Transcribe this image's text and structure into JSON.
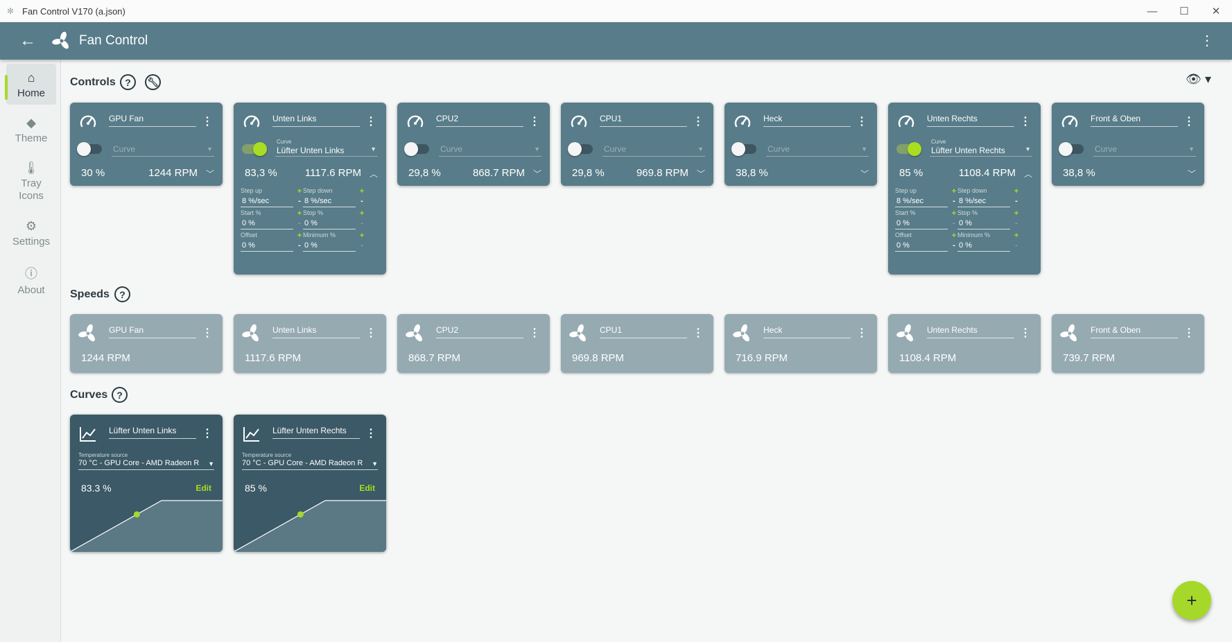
{
  "window": {
    "title": "Fan Control V170 (a.json)"
  },
  "header": {
    "title": "Fan Control"
  },
  "nav": [
    {
      "label": "Home",
      "icon": "home-icon",
      "active": true
    },
    {
      "label": "Theme",
      "icon": "paint-bucket-icon"
    },
    {
      "label": "Tray Icons",
      "icon": "thermometer-icon"
    },
    {
      "label": "Settings",
      "icon": "gear-icon"
    },
    {
      "label": "About",
      "icon": "info-icon"
    }
  ],
  "sections": {
    "controls": "Controls",
    "speeds": "Speeds",
    "curves": "Curves"
  },
  "controls": [
    {
      "name": "GPU Fan",
      "enabled": false,
      "curve": "Curve",
      "percent": "30 %",
      "rpm": "1244 RPM",
      "expanded": false
    },
    {
      "name": "Unten Links",
      "enabled": true,
      "curve_label": "Curve",
      "curve": "Lüfter Unten Links",
      "percent": "83,3 %",
      "rpm": "1117.6 RPM",
      "expanded": true,
      "step_up_label": "Step up",
      "step_up": "8 %/sec",
      "step_down_label": "Step down",
      "step_down": "8 %/sec",
      "start_label": "Start %",
      "start": "0 %",
      "stop_label": "Stop %",
      "stop": "0 %",
      "offset_label": "Offset",
      "offset": "0 %",
      "minimum_label": "Minimum %",
      "minimum": "0 %"
    },
    {
      "name": "CPU2",
      "enabled": false,
      "curve": "Curve",
      "percent": "29,8 %",
      "rpm": "868.7 RPM",
      "expanded": false
    },
    {
      "name": "CPU1",
      "enabled": false,
      "curve": "Curve",
      "percent": "29,8 %",
      "rpm": "969.8 RPM",
      "expanded": false
    },
    {
      "name": "Heck",
      "enabled": false,
      "curve": "Curve",
      "percent": "38,8 %",
      "rpm": "",
      "expanded": false
    },
    {
      "name": "Unten Rechts",
      "enabled": true,
      "curve_label": "Curve",
      "curve": "Lüfter Unten Rechts",
      "percent": "85 %",
      "rpm": "1108.4 RPM",
      "expanded": true,
      "step_up_label": "Step up",
      "step_up": "8 %/sec",
      "step_down_label": "Step down",
      "step_down": "8 %/sec",
      "start_label": "Start %",
      "start": "0 %",
      "stop_label": "Stop %",
      "stop": "0 %",
      "offset_label": "Offset",
      "offset": "0 %",
      "minimum_label": "Minimum %",
      "minimum": "0 %"
    },
    {
      "name": "Front & Oben",
      "enabled": false,
      "curve": "Curve",
      "percent": "38,8 %",
      "rpm": "",
      "expanded": false
    }
  ],
  "speeds": [
    {
      "name": "GPU Fan",
      "value": "1244 RPM"
    },
    {
      "name": "Unten Links",
      "value": "1117.6 RPM"
    },
    {
      "name": "CPU2",
      "value": "868.7 RPM"
    },
    {
      "name": "CPU1",
      "value": "969.8 RPM"
    },
    {
      "name": "Heck",
      "value": "716.9 RPM"
    },
    {
      "name": "Unten Rechts",
      "value": "1108.4 RPM"
    },
    {
      "name": "Front & Oben",
      "value": "739.7 RPM"
    }
  ],
  "curves": [
    {
      "name": "Lüfter Unten Links",
      "temp_label": "Temperature source",
      "temp_source": "70 °C - GPU Core - AMD Radeon R",
      "percent": "83.3 %",
      "edit": "Edit",
      "level": 0.833
    },
    {
      "name": "Lüfter Unten Rechts",
      "temp_label": "Temperature source",
      "temp_source": "70 °C - GPU Core - AMD Radeon R",
      "percent": "85 %",
      "edit": "Edit",
      "level": 0.85
    }
  ],
  "colors": {
    "accent": "#a6d82a",
    "header": "#587c89",
    "card": "#587c89",
    "speed_card": "#96aab2",
    "curve_card": "#3b5966"
  }
}
